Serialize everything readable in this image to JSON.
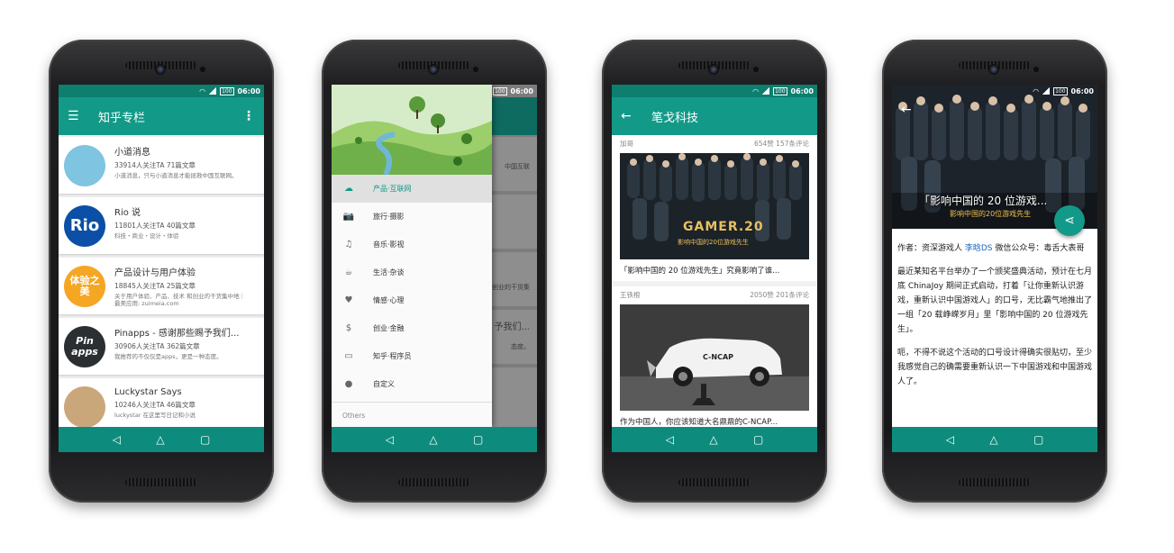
{
  "status": {
    "battery": "100",
    "time": "06:00"
  },
  "navbar": {
    "back": "◁",
    "home": "△",
    "recent": "▢"
  },
  "screen1": {
    "title": "知乎专栏",
    "columns": [
      {
        "name": "小道消息",
        "stats": "33914人关注TA  71篇文章",
        "desc": "小道消息，只与小道消息才能拯救中国互联网。",
        "avatar_text": "",
        "color": "#7fc4e0"
      },
      {
        "name": "Rio 说",
        "stats": "11801人关注TA  40篇文章",
        "desc": "科技・商业・设计・体验",
        "avatar_text": "Rio",
        "color": "#0b4fa6"
      },
      {
        "name": "产品设计与用户体验",
        "stats": "18845人关注TA  25篇文章",
        "desc": "关于用户体验、产品、技术 和创业的干货集中地｜最美应用: zuimeia.com",
        "avatar_text": "体验之美",
        "color": "#f5a623"
      },
      {
        "name": "Pinapps - 感谢那些赐予我们...",
        "stats": "30906人关注TA  362篇文章",
        "desc": "我推荐的不仅仅是apps，更是一种态度。",
        "avatar_text": "Pin apps",
        "color": "#2b2f31"
      },
      {
        "name": "Luckystar Says",
        "stats": "10246人关注TA  46篇文章",
        "desc": "luckystar 在这里写日记和小说",
        "avatar_text": "",
        "color": "#caa77a"
      }
    ]
  },
  "screen2": {
    "items": [
      {
        "label": "产品·互联网",
        "icon": "cloud-icon",
        "glyph": "☁",
        "active": true
      },
      {
        "label": "旅行·摄影",
        "icon": "camera-icon",
        "glyph": "📷",
        "active": false
      },
      {
        "label": "音乐·影视",
        "icon": "music-library-icon",
        "glyph": "♫",
        "active": false
      },
      {
        "label": "生活·杂谈",
        "icon": "coffee-icon",
        "glyph": "☕",
        "active": false
      },
      {
        "label": "情感·心理",
        "icon": "heart-icon",
        "glyph": "♥",
        "active": false
      },
      {
        "label": "创业·金融",
        "icon": "dollar-icon",
        "glyph": "$",
        "active": false
      },
      {
        "label": "知乎·程序员",
        "icon": "laptop-icon",
        "glyph": "▭",
        "active": false
      },
      {
        "label": "自定义",
        "icon": "person-icon",
        "glyph": "●",
        "active": false
      }
    ],
    "section": "Others",
    "bg_texts": [
      "中国互联",
      "和创业的干货集",
      "予我们...",
      "态度。"
    ]
  },
  "screen3": {
    "title": "笔戈科技",
    "posts": [
      {
        "author": "加哥",
        "stats": "654赞  157条评论",
        "title": "「影响中国的 20 位游戏先生」究竟影响了谁...",
        "img_label": "GAMER.20",
        "img_sub": "影响中国的20位游戏先生"
      },
      {
        "author": "王铁根",
        "stats": "2050赞  201条评论",
        "title": "作为中国人，你应该知道大名鼎鼎的C-NCAP...",
        "img_label": "C-NCAP",
        "img_sub": ""
      }
    ]
  },
  "screen4": {
    "hero_title": "「影响中国的 20 位游戏...",
    "hero_sub": "影响中国的20位游戏先生",
    "byline_prefix": "作者：资深游戏人 ",
    "byline_link": "李晗DS",
    "byline_suffix": "   微信公众号：毒舌大表哥",
    "para1": "最近某知名平台举办了一个颁奖盛典活动，预计在七月底 ChinaJoy 期间正式启动，打着「让你重新认识游戏，重新认识中国游戏人」的口号，无比霸气地推出了一组「20 载峥嵘岁月」里「影响中国的 20 位游戏先生」。",
    "para2": "呃，不得不说这个活动的口号设计得确实很贴切，至少我感觉自己的确需要重新认识一下中国游戏和中国游戏人了。"
  }
}
